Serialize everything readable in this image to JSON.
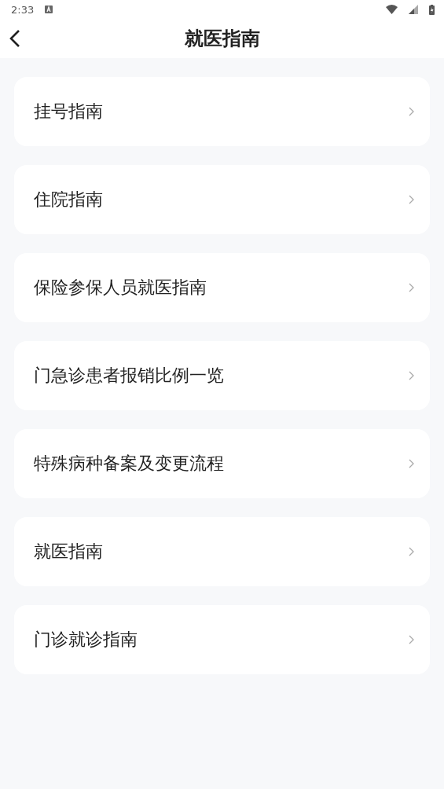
{
  "status_bar": {
    "time": "2:33"
  },
  "header": {
    "title": "就医指南"
  },
  "items": [
    {
      "label": "挂号指南"
    },
    {
      "label": "住院指南"
    },
    {
      "label": "保险参保人员就医指南"
    },
    {
      "label": "门急诊患者报销比例一览"
    },
    {
      "label": "特殊病种备案及变更流程"
    },
    {
      "label": "就医指南"
    },
    {
      "label": "门诊就诊指南"
    }
  ]
}
